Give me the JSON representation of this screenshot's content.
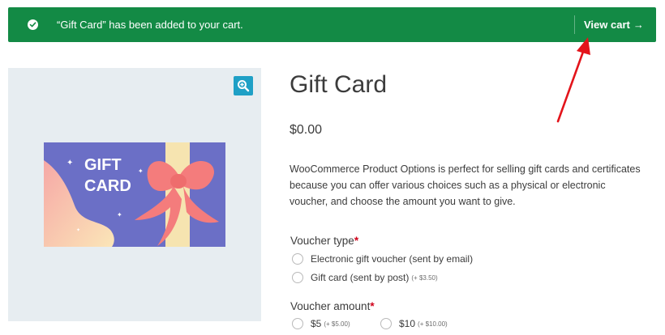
{
  "notice": {
    "message": "“Gift Card” has been added to your cart.",
    "view_cart_label": "View cart",
    "arrow_glyph": "→",
    "background": "#138a45"
  },
  "gallery": {
    "zoom_icon": "zoom-in-icon",
    "image": {
      "line1": "GIFT",
      "line2": "CARD"
    }
  },
  "product": {
    "title": "Gift Card",
    "price": "$0.00",
    "description": "WooCommerce Product Options is perfect for selling gift cards and certificates because you can offer various choices such as a physical or electronic voucher, and choose the amount you want to give."
  },
  "voucher_type": {
    "label": "Voucher type",
    "required_mark": "*",
    "options": [
      {
        "label": "Electronic gift voucher (sent by email)",
        "extra": ""
      },
      {
        "label": "Gift card (sent by post)",
        "extra": "(+ $3.50)"
      }
    ]
  },
  "voucher_amount": {
    "label": "Voucher amount",
    "required_mark": "*",
    "options": [
      {
        "label": "$5",
        "extra": "(+ $5.00)"
      },
      {
        "label": "$10",
        "extra": "(+ $10.00)"
      }
    ]
  },
  "colors": {
    "accent_blue": "#1fa0c6",
    "required_red": "#d0021b",
    "annotation_arrow": "#e3141b"
  }
}
